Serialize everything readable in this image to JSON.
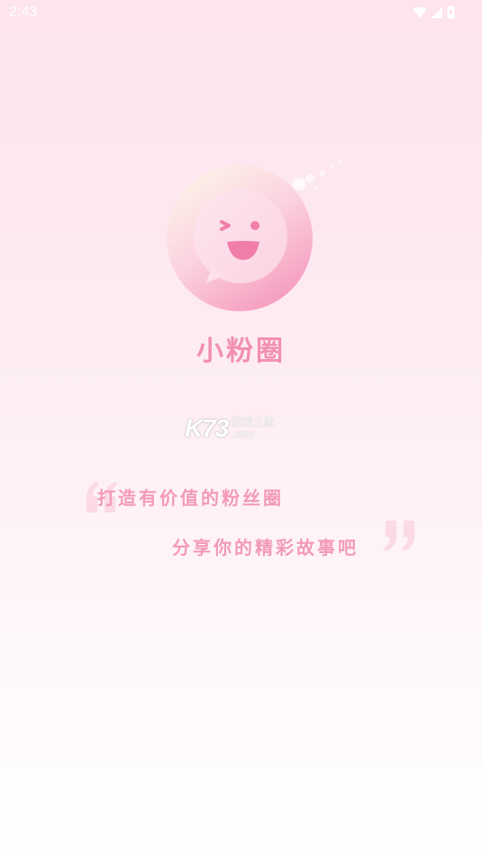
{
  "status_bar": {
    "time": "2:43",
    "icons": [
      "wifi-icon",
      "signal-icon",
      "battery-icon"
    ]
  },
  "splash": {
    "app_name": "小粉圈",
    "slogan_line1": "打造有价值的粉丝圈",
    "slogan_line2": "分享你的精彩故事吧"
  },
  "watermark": {
    "brand": "K73",
    "site_cn": "游戏之家",
    "site_com": ".com"
  },
  "colors": {
    "brand_pink": "#f28fb1",
    "background_top": "#fde4ee",
    "background_bottom": "#ffffff"
  }
}
